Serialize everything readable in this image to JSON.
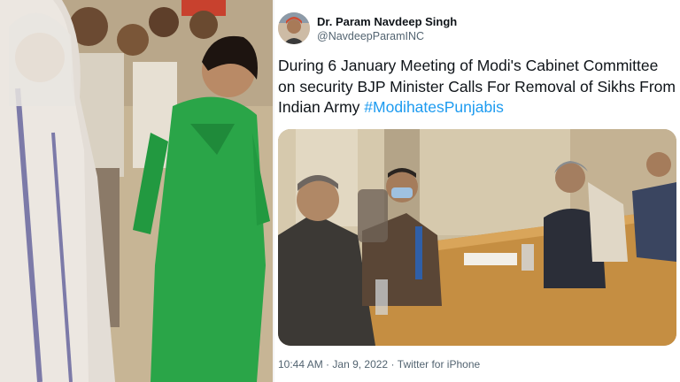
{
  "tweet": {
    "author": {
      "name": "Dr. Param Navdeep Singh",
      "handle": "@NavdeepParamINC"
    },
    "text": "During 6 January Meeting of Modi's Cabinet Committee on security BJP Minister Calls For Removal of Sikhs From Indian Army ",
    "hashtag": "#ModihatesPunjabis",
    "meta": {
      "time": "10:44 AM",
      "separator": "·",
      "date": "Jan 9, 2022",
      "source": "Twitter for iPhone"
    }
  },
  "colors": {
    "link": "#1d9bf0",
    "text_primary": "#0f1419",
    "text_secondary": "#536471"
  }
}
